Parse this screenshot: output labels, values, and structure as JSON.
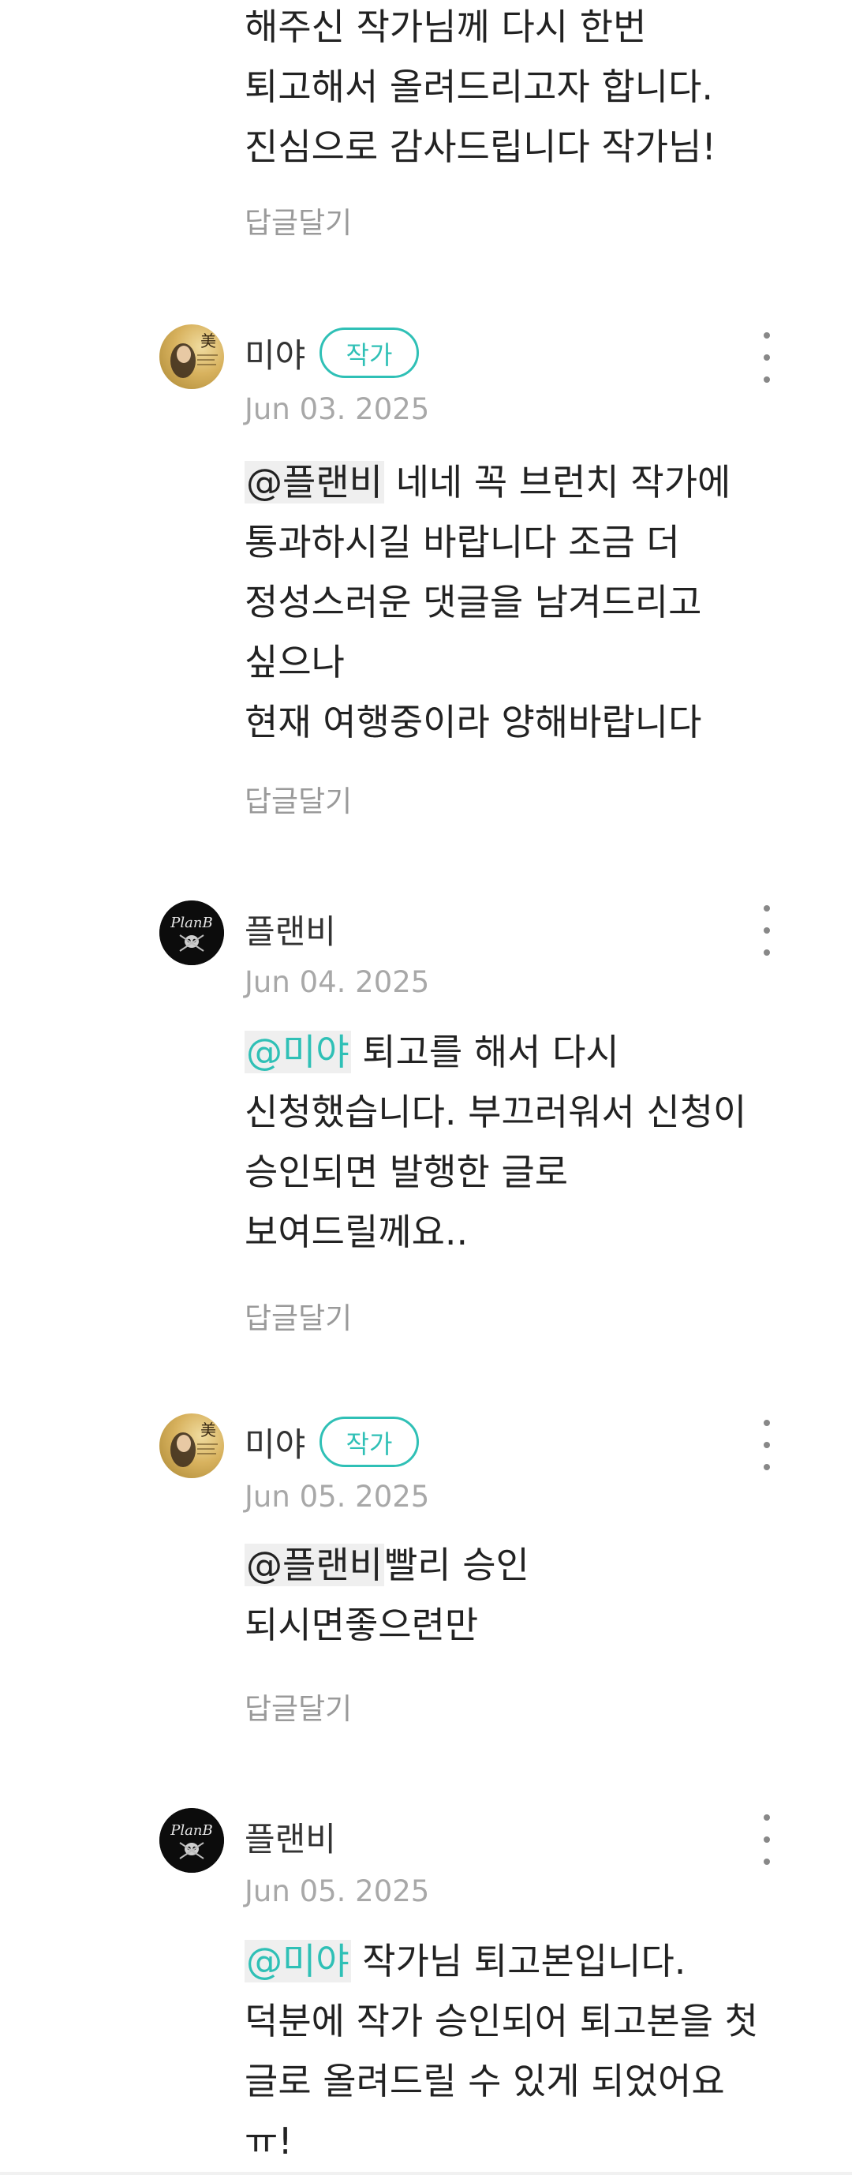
{
  "continuation": {
    "lines": [
      "해주신 작가님께 다시 한번",
      "퇴고해서 올려드리고자 합니다.",
      "진심으로 감사드립니다 작가님!"
    ],
    "reply_label": "답글달기"
  },
  "comments": [
    {
      "author": "미야",
      "badge": "작가",
      "avatar": "book-cover-avatar",
      "date": "Jun 03. 2025",
      "mention": "@플랜비",
      "first_line_rest": " 네네 꼭 브런치 작가에",
      "lines": [
        "통과하시길 바랍니다 조금 더",
        "정성스러운 댓글을 남겨드리고",
        "싶으나",
        "현재 여행중이라 양해바랍니다"
      ],
      "reply_label": "답글달기"
    },
    {
      "author": "플랜비",
      "avatar": "planb-skull-logo-avatar",
      "avatar_text": "PlanB",
      "date": "Jun 04. 2025",
      "mention": "@미야",
      "first_line_rest": " 퇴고를 해서 다시",
      "lines": [
        "신청했습니다. 부끄러워서 신청이",
        "승인되면 발행한 글로",
        "보여드릴께요.."
      ],
      "reply_label": "답글달기"
    },
    {
      "author": "미야",
      "badge": "작가",
      "avatar": "book-cover-avatar",
      "date": "Jun 05. 2025",
      "mention": "@플랜비",
      "first_line_rest": "빨리 승인",
      "lines": [
        "되시면좋으련만"
      ],
      "reply_label": "답글달기"
    },
    {
      "author": "플랜비",
      "avatar": "planb-skull-logo-avatar",
      "avatar_text": "PlanB",
      "date": "Jun 05. 2025",
      "mention": "@미야",
      "first_line_rest": " 작가님 퇴고본입니다.",
      "lines": [
        "덕분에 작가 승인되어 퇴고본을 첫",
        "글로 올려드릴 수 있게 되었어요",
        "ㅠ!"
      ]
    }
  ],
  "colors": {
    "accent": "#2fc0b6",
    "muted": "#a8a8a8",
    "mention_bg": "#efefef"
  }
}
